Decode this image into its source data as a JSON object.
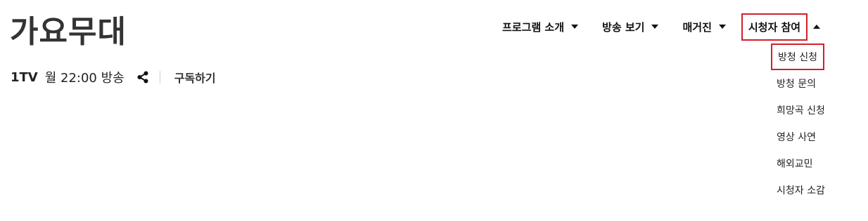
{
  "program": {
    "title": "가요무대",
    "channel": "1TV",
    "schedule": "월 22:00 방송",
    "subscribe_label": "구독하기",
    "share_icon": "share-icon"
  },
  "nav": {
    "items": [
      {
        "label": "프로그램 소개",
        "caret": "down"
      },
      {
        "label": "방송 보기",
        "caret": "down"
      },
      {
        "label": "매거진",
        "caret": "down"
      },
      {
        "label": "시청자 참여",
        "caret": "up",
        "active": true
      }
    ],
    "submenu": [
      {
        "label": "방청 신청",
        "active": true
      },
      {
        "label": "방청 문의"
      },
      {
        "label": "희망곡 신청"
      },
      {
        "label": "영상 사연"
      },
      {
        "label": "해외교민"
      },
      {
        "label": "시청자 소감"
      }
    ]
  },
  "colors": {
    "highlight": "#d0202a",
    "text": "#222222",
    "divider": "#cfcfcf"
  }
}
